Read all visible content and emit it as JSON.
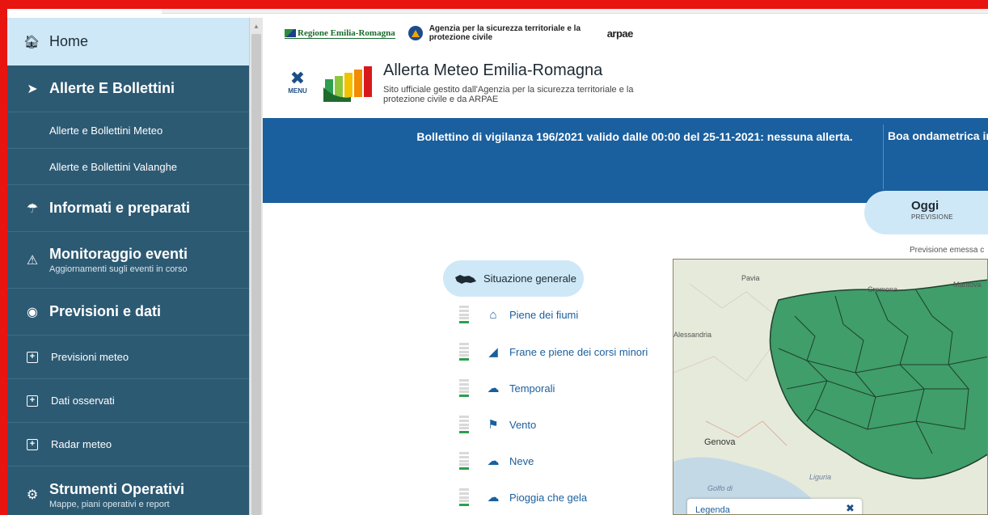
{
  "sidebar": {
    "home": {
      "label": "Home",
      "icon": "home-icon"
    },
    "sections": [
      {
        "label": "Allerte E Bollettini",
        "icon": "megaphone-icon"
      },
      {
        "label": "Informati e preparati",
        "icon": "umbrella-icon"
      },
      {
        "label": "Monitoraggio eventi",
        "sub": "Aggiornamenti sugli eventi in corso",
        "icon": "warning-icon"
      },
      {
        "label": "Previsioni e dati",
        "icon": "webcam-icon"
      },
      {
        "label": "Strumenti Operativi",
        "sub": "Mappe, piani operativi e report",
        "icon": "tools-icon"
      }
    ],
    "allerte_items": [
      "Allerte e Bollettini Meteo",
      "Allerte e Bollettini Valanghe"
    ],
    "previsioni_items": [
      "Previsioni meteo",
      "Dati osservati",
      "Radar meteo"
    ]
  },
  "header": {
    "logo_regione": "Regione Emilia-Romagna",
    "logo_agenzia": "Agenzia per la sicurezza territoriale e la protezione civile",
    "logo_arpae": "arpae",
    "menu_label": "MENU",
    "site_title": "Allerta Meteo Emilia-Romagna",
    "site_subtitle": "Sito ufficiale gestito dall'Agenzia per la sicurezza territoriale e la protezione civile e da ARPAE"
  },
  "banner": {
    "bollettino": "Bollettino di vigilanza 196/2021 valido dalle 00:00 del 25-11-2021: nessuna allerta.",
    "boa": "Boa ondametrica in"
  },
  "forecast": {
    "tab_label": "Oggi",
    "tab_sub": "PREVISIONE",
    "emessa": "Previsione emessa c"
  },
  "events": {
    "general": "Situazione generale",
    "items": [
      {
        "label": "Piene dei fiumi",
        "icon": "river-flood-icon"
      },
      {
        "label": "Frane e piene dei corsi minori",
        "icon": "landslide-icon"
      },
      {
        "label": "Temporali",
        "icon": "thunderstorm-icon"
      },
      {
        "label": "Vento",
        "icon": "windsock-icon"
      },
      {
        "label": "Neve",
        "icon": "snow-icon"
      },
      {
        "label": "Pioggia che gela",
        "icon": "freezing-rain-icon"
      }
    ]
  },
  "map": {
    "places": [
      "Pavia",
      "Cremona",
      "Mantova",
      "Alessandria",
      "Genova",
      "Liguria",
      "Golfo di"
    ],
    "legend_label": "Legenda",
    "colors": {
      "zone_fill": "#3f9e6a",
      "zone_stroke": "#1f3f2a",
      "sea": "#c4d9e6"
    }
  },
  "colors": {
    "sidebar": "#2d5a73",
    "home_bg": "#cfe8f7",
    "banner": "#1a5f9e",
    "accent_red": "#e8140f"
  }
}
